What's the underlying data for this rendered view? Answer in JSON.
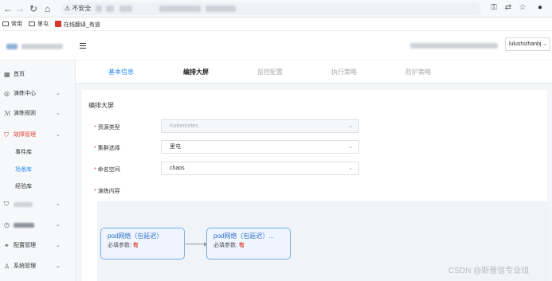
{
  "browser": {
    "back": "←",
    "forward": "→",
    "reload": "↻",
    "home": "⌂",
    "security_badge": "不安全",
    "bookmarks": [
      {
        "label": "常用",
        "icon": "folder-icon"
      },
      {
        "label": "里屯",
        "icon": "folder-icon"
      },
      {
        "label": "在线翻译_有道",
        "icon": "youdao-icon"
      }
    ]
  },
  "header": {
    "user": "lulushizhanbj"
  },
  "sidebar": {
    "items": [
      {
        "label": "首页",
        "icon": "grid-icon",
        "chevron": ""
      },
      {
        "label": "演练中心",
        "icon": "target-icon",
        "chevron": "⌄"
      },
      {
        "label": "演练规则",
        "icon": "chart-icon",
        "chevron": "⌄"
      },
      {
        "label": "故障管理",
        "icon": "shield-icon",
        "chevron": "⌄"
      }
    ],
    "subitems": [
      {
        "label": "事件库"
      },
      {
        "label": "场景库"
      },
      {
        "label": "经验库"
      }
    ],
    "bottom_items": [
      {
        "label": "",
        "icon": "shield-icon",
        "chevron": "⌄"
      },
      {
        "label": "",
        "icon": "clock-icon",
        "chevron": "⌄"
      },
      {
        "label": "配置管理",
        "icon": "link-icon",
        "chevron": "⌄"
      },
      {
        "label": "系统管理",
        "icon": "user-icon",
        "chevron": "⌄"
      }
    ]
  },
  "tabs": [
    {
      "label": "基本信息",
      "state": "done"
    },
    {
      "label": "编排大屏",
      "state": "current"
    },
    {
      "label": "监控配置",
      "state": "pending"
    },
    {
      "label": "执行策略",
      "state": "pending"
    },
    {
      "label": "防护策略",
      "state": "pending"
    }
  ],
  "form": {
    "section_title": "编排大屏",
    "fields": [
      {
        "label": "资源类型",
        "value": "Kubernetes",
        "disabled": true
      },
      {
        "label": "集群选择",
        "value": "里屯",
        "disabled": false
      },
      {
        "label": "命名空间",
        "value": "chaos",
        "disabled": false
      }
    ],
    "content_label": "演练内容"
  },
  "canvas": {
    "nodes": [
      {
        "title": "pod网络（包延迟）",
        "param_label": "必填参数:",
        "param_value": "有"
      },
      {
        "title": "pod网络（包延迟）...",
        "param_label": "必填参数:",
        "param_value": "有"
      }
    ]
  },
  "watermark": "CSDN @斯普信专业组",
  "colors": {
    "accent": "#2d8cf0",
    "danger": "#e2473b",
    "node_border": "#78aee6"
  }
}
